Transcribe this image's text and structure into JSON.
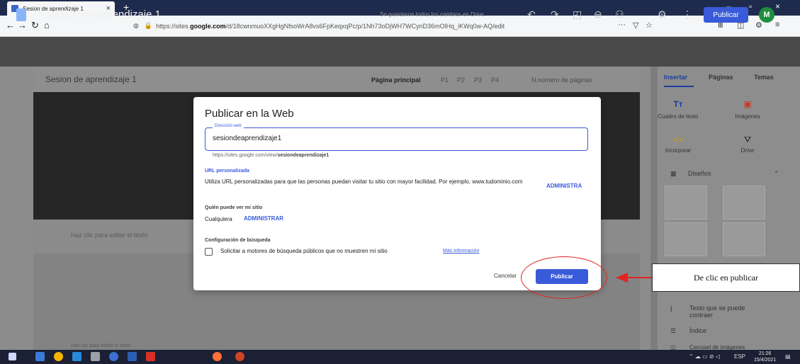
{
  "browser": {
    "tab_title": "Sesion de aprendizaje 1",
    "tab_close": "×",
    "new_tab": "+",
    "url_prefix": "https://sites.",
    "url_domain": "google.com",
    "url_rest": "/d/18cwnmuoXXgHgNfsoWrA8vs6FpKeqxqPc/p/1Nh73oDjWH7WCynD36mOlHq_iKWq0w-AQ/edit",
    "more_icon": "···",
    "window_controls": [
      "–",
      "▫",
      "×"
    ]
  },
  "sites_toolbar": {
    "title": "Sesión de aprendizaje 1",
    "saved_status": "Se guardaron todos los cambios en Drive.",
    "publish_label": "Publicar",
    "avatar_letter": "M"
  },
  "site_preview": {
    "site_name": "Sesion de aprendizaje 1",
    "nav": [
      "Página principal",
      "P1",
      "P2",
      "P3",
      "P4",
      "N.número de páginas"
    ],
    "edit_hint": "Haz clic para editar el texto",
    "edit_hint_2": "Haz clic para editar el texto"
  },
  "right_panel": {
    "tabs": [
      "Insertar",
      "Páginas",
      "Temas"
    ],
    "insert_items": [
      {
        "icon": "text-box-icon",
        "glyph": "Tт",
        "label": "Cuadro de texto"
      },
      {
        "icon": "image-icon",
        "glyph": "▣",
        "label": "Imágenes"
      },
      {
        "icon": "embed-icon",
        "glyph": "<>",
        "label": "Incorporar"
      },
      {
        "icon": "drive-icon",
        "glyph": "⛛",
        "label": "Drive"
      }
    ],
    "layouts_label": "Diseños",
    "collapsible_label": "Texto que se puede contraer",
    "index_label": "Índice",
    "carousel_label": "Carrusel de imágenes"
  },
  "dialog": {
    "title": "Publicar en la Web",
    "field_label": "Dirección web",
    "field_value": "sesiondeaprendizaje1",
    "url_preview_prefix": "https://sites.google.com/view/",
    "url_preview_name": "sesiondeaprendizaje1",
    "custom_url_heading": "URL personalizada",
    "custom_url_text": "Utiliza URL personalizadas para que las personas puedan visitar tu sitio con mayor facilidad. Por ejemplo, www.tudominio.com",
    "custom_url_link": "ADMINISTRA",
    "who_heading": "Quién puede ver mi sitio",
    "who_value": "Cualquiera",
    "who_link": "ADMINISTRAR",
    "search_heading": "Configuración de búsqueda",
    "search_checkbox_label": "Solicitar a motores de búsqueda públicos que no muestren mi sitio",
    "search_more_link": "Más información",
    "cancel_label": "Cancelar",
    "publish_label": "Publicar"
  },
  "annotation": {
    "callout_text": "De clic en publicar",
    "color": "#e52222"
  },
  "taskbar": {
    "language": "ESP",
    "time": "21:26",
    "date": "15/4/2021"
  }
}
